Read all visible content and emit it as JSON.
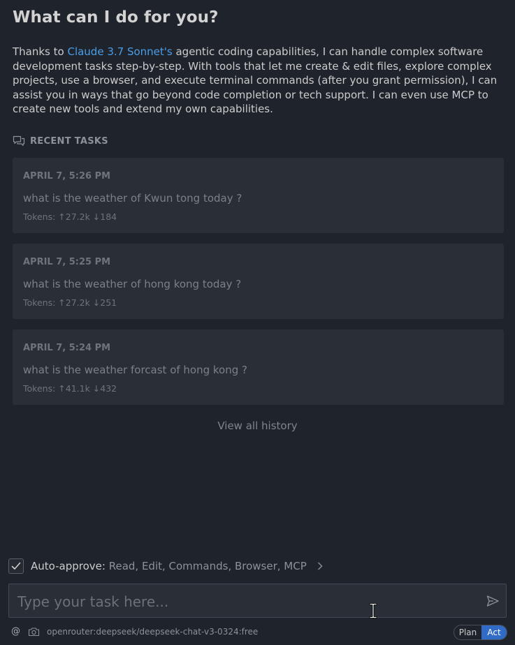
{
  "header": {
    "title": "What can I do for you?"
  },
  "intro": {
    "prefix": "Thanks to ",
    "link_text": "Claude 3.7 Sonnet's",
    "suffix": " agentic coding capabilities, I can handle complex software development tasks step-by-step. With tools that let me create & edit files, explore complex projects, use a browser, and execute terminal commands (after you grant permission), I can assist you in ways that go beyond code completion or tech support. I can even use MCP to create new tools and extend my own capabilities."
  },
  "recent": {
    "icon": "chat-history-icon",
    "title": "RECENT TASKS",
    "tasks": [
      {
        "date": "APRIL 7, 5:26 PM",
        "text": "what is the weather of Kwun tong today ?",
        "tokens": "Tokens: ↑27.2k ↓184"
      },
      {
        "date": "APRIL 7, 5:25 PM",
        "text": "what is the weather of hong kong today ?",
        "tokens": "Tokens: ↑27.2k ↓251"
      },
      {
        "date": "APRIL 7, 5:24 PM",
        "text": "what is the weather forcast of hong kong ?",
        "tokens": "Tokens: ↑41.1k ↓432"
      }
    ],
    "view_all": "View all history"
  },
  "auto_approve": {
    "checked": true,
    "label": "Auto-approve:",
    "values": "Read, Edit, Commands, Browser, MCP"
  },
  "input": {
    "placeholder": "Type your task here..."
  },
  "footer": {
    "at_label": "@",
    "model": "openrouter:deepseek/deepseek-chat-v3-0324:free",
    "mode": {
      "plan_label": "Plan",
      "act_label": "Act",
      "active": "Act"
    }
  },
  "colors": {
    "background": "#1f232b",
    "card": "#2a2e36",
    "link": "#4a9ee8",
    "act_active": "#2f6bc7"
  }
}
